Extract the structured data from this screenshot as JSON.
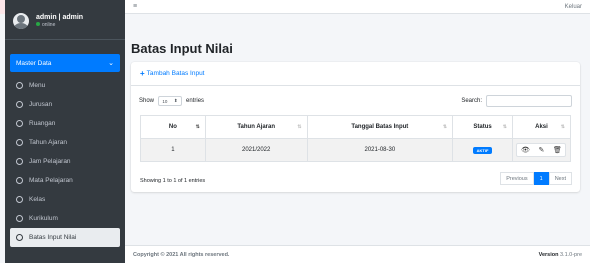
{
  "user": {
    "name": "admin | admin",
    "status": "online"
  },
  "topbar": {
    "menu_icon": "≡",
    "logout": "Keluar"
  },
  "sidebar": {
    "section": "Master Data",
    "items": [
      {
        "label": "Menu"
      },
      {
        "label": "Jurusan"
      },
      {
        "label": "Ruangan"
      },
      {
        "label": "Tahun Ajaran"
      },
      {
        "label": "Jam Pelajaran"
      },
      {
        "label": "Mata Pelajaran"
      },
      {
        "label": "Kelas"
      },
      {
        "label": "Kurikulum"
      },
      {
        "label": "Batas Input Nilai"
      }
    ]
  },
  "page": {
    "title": "Batas Input Nilai"
  },
  "card": {
    "add_label": "Tambah Batas Input",
    "show_label": "Show",
    "entries_label": "entries",
    "entries_value": "10",
    "search_label": "Search:",
    "search_value": ""
  },
  "table": {
    "columns": [
      "No",
      "Tahun Ajaran",
      "Tanggal Batas Input",
      "Status",
      "Aksi"
    ],
    "rows": [
      {
        "no": "1",
        "tahun": "2021/2022",
        "tanggal": "2021-08-30",
        "status": "AKTIF"
      }
    ]
  },
  "info": "Showing 1 to 1 of 1 entries",
  "pagination": {
    "prev": "Previous",
    "page": "1",
    "next": "Next"
  },
  "footer": {
    "copyright": "Copyright © 2021 All rights reserved.",
    "version_label": "Version",
    "version": "3.1.0-pre"
  },
  "colors": {
    "primary": "#007bff",
    "sidebar": "#343a40"
  }
}
